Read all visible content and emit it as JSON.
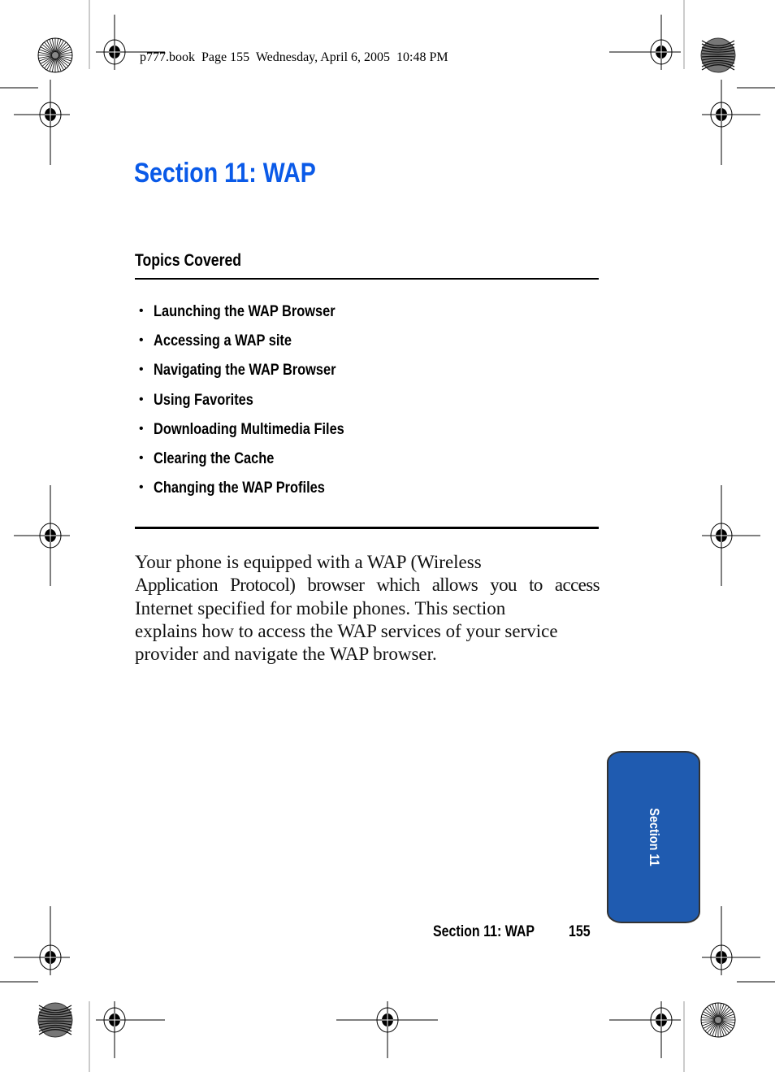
{
  "header": {
    "print_stamp": "p777.book  Page 155  Wednesday, April 6, 2005  10:48 PM"
  },
  "page": {
    "title": "Section 11: WAP",
    "topics_heading": "Topics Covered",
    "bullet_glyph": "•",
    "topics": [
      "Launching the WAP Browser",
      "Accessing a WAP site",
      "Navigating the WAP Browser",
      "Using Favorites",
      "Downloading Multimedia Files",
      "Clearing the Cache",
      "Changing the WAP Profiles"
    ],
    "body_lines": [
      "Your phone is equipped with a WAP (Wireless",
      "Application Protocol) browser which allows you to access",
      "Internet specified for mobile phones. This section",
      "explains how to access the WAP services of your service",
      "provider and navigate the WAP browser."
    ]
  },
  "side_tab": {
    "label": "Section 11",
    "color": "#1f5bb0"
  },
  "footer": {
    "section_title": "Section 11: WAP",
    "page_number": "155"
  },
  "colors": {
    "title": "#0a5ae8",
    "text": "#000000"
  }
}
